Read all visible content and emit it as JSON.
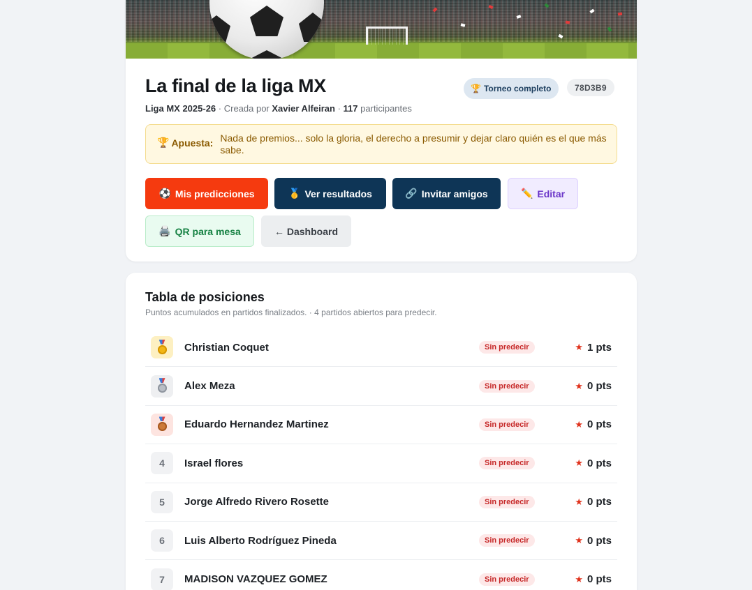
{
  "header": {
    "title": "La final de la liga MX",
    "league": "Liga MX 2025-26",
    "created_by_prefix": "· Creada por",
    "creator": "Xavier Alfeiran",
    "participants_count": "117",
    "participants_label": "participantes",
    "status_badge": "Torneo completo",
    "code": "78D3B9"
  },
  "bet": {
    "label": "Apuesta:",
    "text": "Nada de premios... solo la gloria, el derecho a presumir y dejar claro quién es el que más sabe."
  },
  "actions": {
    "predictions": "Mis predicciones",
    "results": "Ver resultados",
    "invite": "Invitar amigos",
    "edit": "Editar",
    "qr": "QR para mesa",
    "dashboard": "← Dashboard"
  },
  "icons": {
    "predictions": "⚽",
    "results": "🥇",
    "invite": "🔗",
    "edit": "✏️",
    "qr": "🖨️",
    "trophy": "🏆"
  },
  "standings": {
    "title": "Tabla de posiciones",
    "subtitle": "Puntos acumulados en partidos finalizados. · 4 partidos abiertos para predecir.",
    "rows": [
      {
        "rank": "1",
        "medal": "gold",
        "name": "Christian Coquet",
        "status": "Sin predecir",
        "points": "1 pts"
      },
      {
        "rank": "2",
        "medal": "silver",
        "name": "Alex Meza",
        "status": "Sin predecir",
        "points": "0 pts"
      },
      {
        "rank": "3",
        "medal": "bronze",
        "name": "Eduardo Hernandez Martinez",
        "status": "Sin predecir",
        "points": "0 pts"
      },
      {
        "rank": "4",
        "medal": "",
        "name": "Israel flores",
        "status": "Sin predecir",
        "points": "0 pts"
      },
      {
        "rank": "5",
        "medal": "",
        "name": "Jorge Alfredo Rivero Rosette",
        "status": "Sin predecir",
        "points": "0 pts"
      },
      {
        "rank": "6",
        "medal": "",
        "name": "Luis Alberto Rodríguez Pineda",
        "status": "Sin predecir",
        "points": "0 pts"
      },
      {
        "rank": "7",
        "medal": "",
        "name": "MADISON VAZQUEZ GOMEZ",
        "status": "Sin predecir",
        "points": "0 pts"
      }
    ]
  },
  "colors": {
    "primary_red": "#f53a0f",
    "navy": "#0e3556",
    "warning_bg": "#fff8e1",
    "status_red": "#c62828"
  }
}
